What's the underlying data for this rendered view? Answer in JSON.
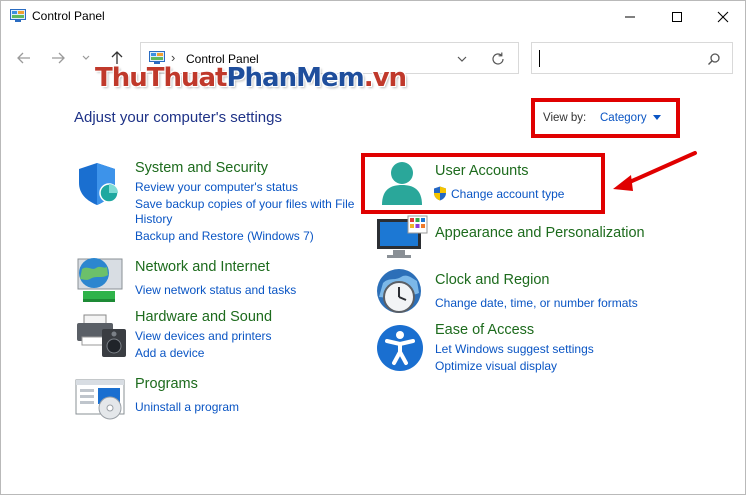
{
  "window": {
    "title": "Control Panel"
  },
  "address": {
    "path": "Control Panel"
  },
  "search": {
    "placeholder": ""
  },
  "watermark": {
    "part1": "ThuThuat",
    "part2": "PhanMem",
    "part3": ".vn"
  },
  "heading": "Adjust your computer's settings",
  "view_by": {
    "label": "View by:",
    "value": "Category"
  },
  "categories": {
    "system": {
      "title": "System and Security",
      "links": [
        "Review your computer's status",
        "Save backup copies of your files with File",
        "History",
        "Backup and Restore (Windows 7)"
      ]
    },
    "network": {
      "title": "Network and Internet",
      "links": [
        "View network status and tasks"
      ]
    },
    "hardware": {
      "title": "Hardware and Sound",
      "links": [
        "View devices and printers",
        "Add a device"
      ]
    },
    "programs": {
      "title": "Programs",
      "links": [
        "Uninstall a program"
      ]
    },
    "users": {
      "title": "User Accounts",
      "links": [
        "Change account type"
      ]
    },
    "appearance": {
      "title": "Appearance and Personalization",
      "links": []
    },
    "clock": {
      "title": "Clock and Region",
      "links": [
        "Change date, time, or number formats"
      ]
    },
    "ease": {
      "title": "Ease of Access",
      "links": [
        "Let Windows suggest settings",
        "Optimize visual display"
      ]
    }
  },
  "colors": {
    "highlight": "#e00000",
    "link": "#0a55c4",
    "category_title": "#1d6b1d",
    "heading": "#1e3287"
  }
}
